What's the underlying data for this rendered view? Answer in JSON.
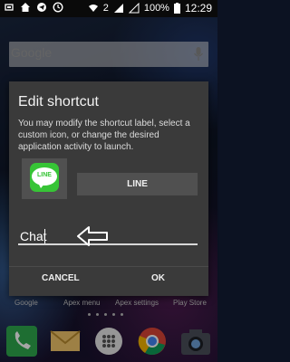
{
  "status_bar": {
    "battery": "100%",
    "time": "12:29",
    "notification_count": "2"
  },
  "home": {
    "search": {
      "placeholder": "Google"
    },
    "labels": [
      "Google",
      "Apex menu",
      "Apex settings",
      "Play Store"
    ],
    "dock": [
      "phone",
      "messages",
      "apps",
      "chrome",
      "camera"
    ]
  },
  "dialog": {
    "title": "Edit shortcut",
    "message": "You may modify the shortcut label, select a custom icon, or change the desired application activity to launch.",
    "app_icon_label": "LINE",
    "app_button": "LINE",
    "label_value": "Chat",
    "cancel": "CANCEL",
    "ok": "OK"
  }
}
